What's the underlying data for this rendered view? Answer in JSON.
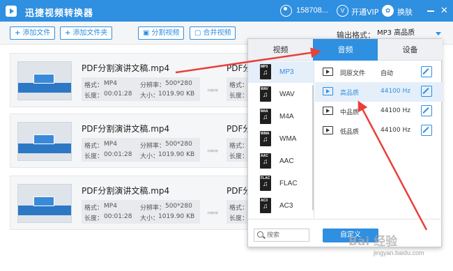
{
  "app": {
    "title": "迅捷视频转换器",
    "user": "158708...",
    "vip_label": "开通VIP",
    "vip_glyph": "V",
    "skin_label": "换肤",
    "skin_glyph": "✿",
    "close_glyph": "✕"
  },
  "toolbar": {
    "add_file": "添加文件",
    "add_folder": "添加文件夹",
    "split": "分割视频",
    "merge": "合并视频",
    "plus_glyph": "+",
    "split_glyph": "▣",
    "merge_glyph": "▢",
    "output_label": "输出格式：",
    "output_value": "MP3  高品质"
  },
  "files": [
    {
      "name": "PDF分割演讲文稿.mp4",
      "name_right": "PDF分",
      "format_label": "格式：",
      "format": "MP4",
      "res_label": "分辨率：",
      "resolution": "500*280",
      "duration_label": "长度：",
      "duration": "00:01:28",
      "size_label": "大小：",
      "size": "1019.90 KB",
      "right_format": "格式：m",
      "right_duration": "长度：0"
    },
    {
      "name": "PDF分割演讲文稿.mp4",
      "name_right": "PDF分",
      "format_label": "格式：",
      "format": "MP4",
      "res_label": "分辨率：",
      "resolution": "500*280",
      "duration_label": "长度：",
      "duration": "00:01:28",
      "size_label": "大小：",
      "size": "1019.90 KB",
      "right_format": "格式：m",
      "right_duration": "长度：0"
    },
    {
      "name": "PDF分割演讲文稿.mp4",
      "name_right": "PDF分",
      "format_label": "格式：",
      "format": "MP4",
      "res_label": "分辨率：",
      "resolution": "500*280",
      "duration_label": "长度：",
      "duration": "00:01:28",
      "size_label": "大小：",
      "size": "1019.90 KB",
      "right_format": "格式：m",
      "right_duration": "长度：0"
    }
  ],
  "convert_arrow": "⇛⇛",
  "popup": {
    "tabs": [
      "视频",
      "音频",
      "设备"
    ],
    "active_tab": "音频",
    "formats": [
      {
        "label": "MP3",
        "tag": "MP3"
      },
      {
        "label": "WAV",
        "tag": "WAV"
      },
      {
        "label": "M4A",
        "tag": "M4A"
      },
      {
        "label": "WMA",
        "tag": "WMA"
      },
      {
        "label": "AAC",
        "tag": "AAC"
      },
      {
        "label": "FLAC",
        "tag": "FLAC"
      },
      {
        "label": "AC3",
        "tag": "AC3"
      }
    ],
    "music_glyph": "♫",
    "active_format": "MP3",
    "qualities": [
      {
        "name": "同原文件",
        "rate": "自动"
      },
      {
        "name": "高品质",
        "rate": "44100 Hz"
      },
      {
        "name": "中品质",
        "rate": "44100 Hz"
      },
      {
        "name": "低品质",
        "rate": "44100 Hz"
      }
    ],
    "active_quality": "高品质",
    "search_placeholder": "搜索",
    "custom_button": "自定义"
  },
  "watermark": {
    "main": "Bai 经验",
    "sub": "jingyan.baidu.com"
  },
  "colors": {
    "accent": "#2f8fe0",
    "annotation": "#e8403a",
    "highlight_bg": "#e4effa"
  }
}
